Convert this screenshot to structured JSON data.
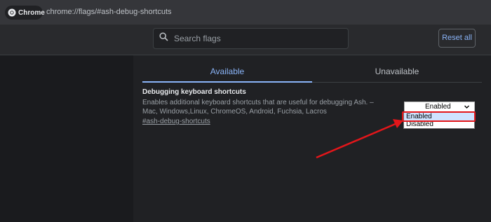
{
  "browser": {
    "chip_label": "Chrome",
    "url": "chrome://flags/#ash-debug-shortcuts"
  },
  "header": {
    "search_placeholder": "Search flags",
    "reset_label": "Reset all"
  },
  "tabs": [
    {
      "label": "Available",
      "active": true
    },
    {
      "label": "Unavailable",
      "active": false
    }
  ],
  "flag": {
    "title": "Debugging keyboard shortcuts",
    "description": "Enables additional keyboard shortcuts that are useful for debugging Ash. – Mac, Windows,Linux, ChromeOS, Android, Fuchsia, Lacros",
    "link": "#ash-debug-shortcuts",
    "selected": "Enabled",
    "options": [
      "Enabled",
      "Disabled"
    ]
  },
  "colors": {
    "accent": "#8ab4f8",
    "annotation": "#e3161a"
  },
  "icons": {
    "browser": "chrome-logo-icon",
    "search": "search-icon",
    "dropdown": "chevron-down-icon"
  }
}
